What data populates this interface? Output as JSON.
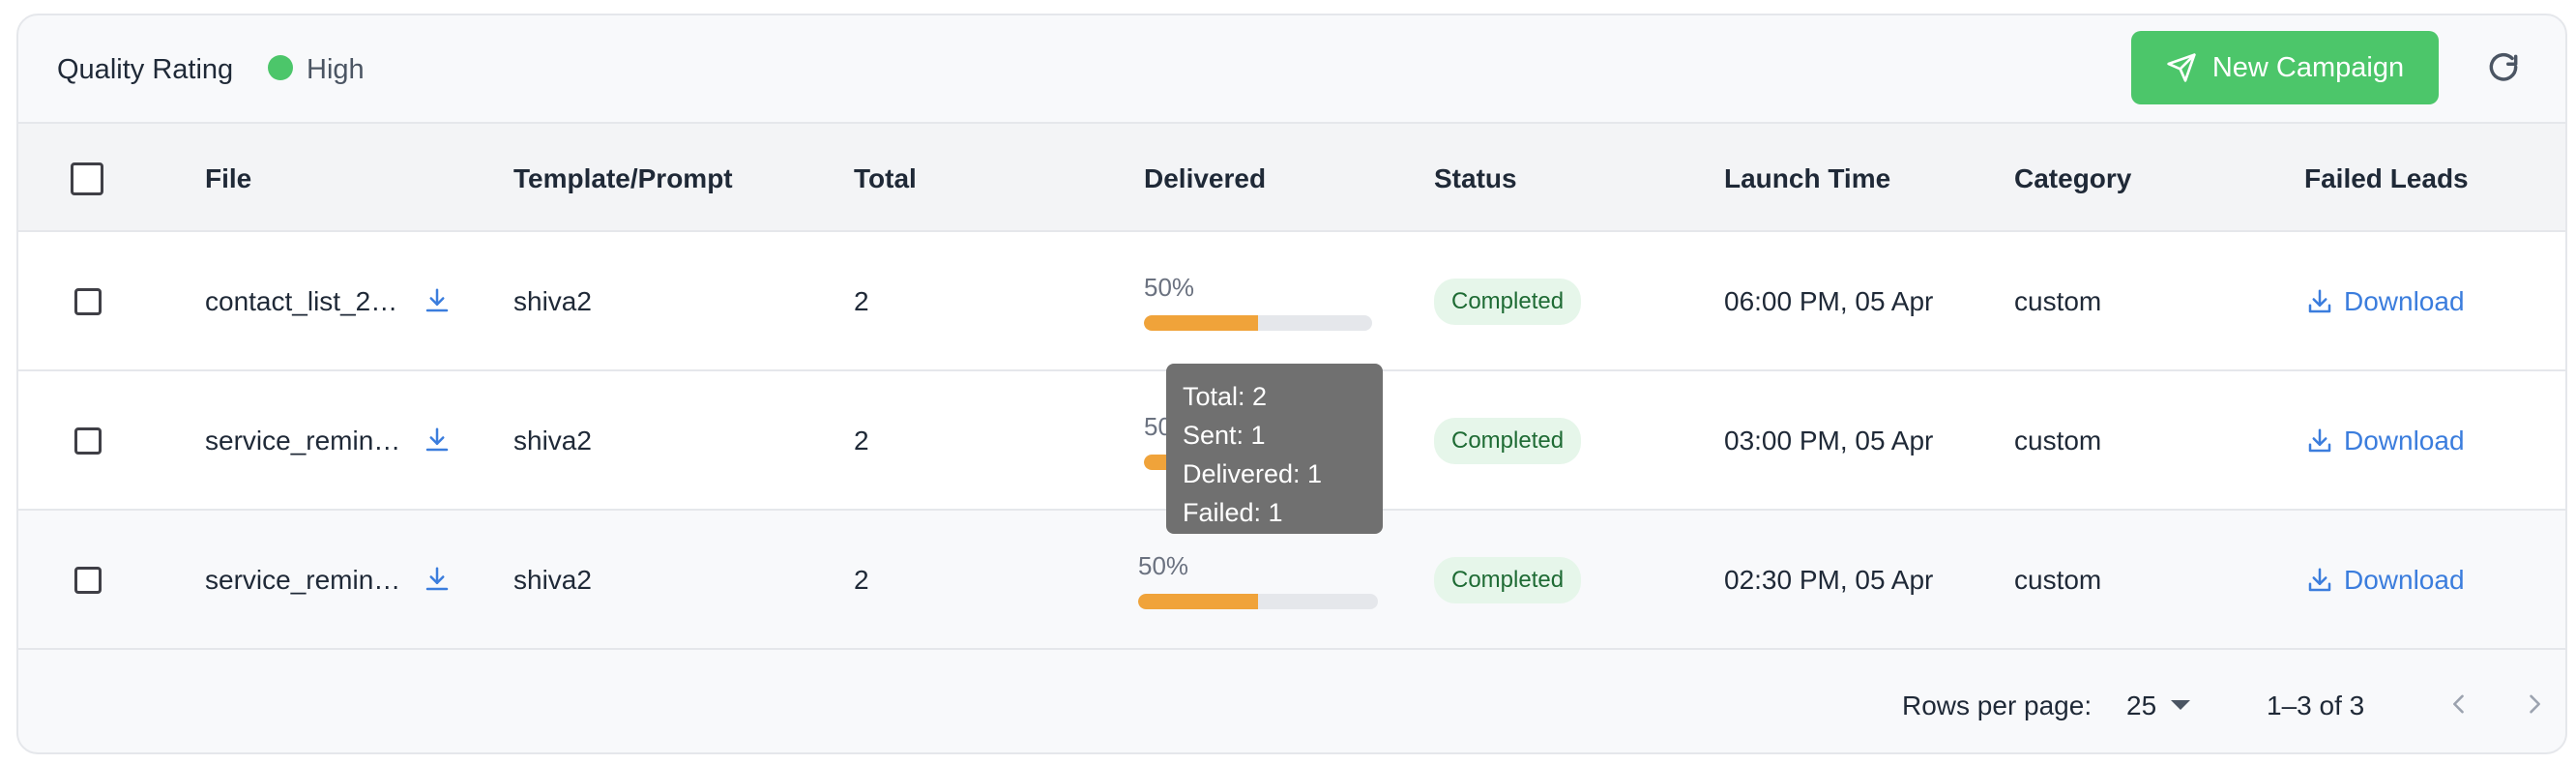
{
  "header": {
    "quality_label": "Quality Rating",
    "quality_value": "High",
    "quality_color": "#4cc66a",
    "new_campaign_label": "New Campaign",
    "refresh_icon": "refresh-icon"
  },
  "table": {
    "columns": [
      "File",
      "Template/Prompt",
      "Total",
      "Delivered",
      "Status",
      "Launch Time",
      "Category",
      "Failed Leads"
    ],
    "rows": [
      {
        "file": "contact_list_2…",
        "template": "shiva2",
        "total": "2",
        "delivered_label": "50%",
        "delivered_fraction": 0.5,
        "status": "Completed",
        "launch_time": "06:00 PM, 05 Apr",
        "category": "custom",
        "failed_leads": "Download"
      },
      {
        "file": "service_remin…",
        "template": "shiva2",
        "total": "2",
        "delivered_label": "50%",
        "delivered_fraction": 0.5,
        "status": "Completed",
        "launch_time": "03:00 PM, 05 Apr",
        "category": "custom",
        "failed_leads": "Download"
      },
      {
        "file": "service_remin…",
        "template": "shiva2",
        "total": "2",
        "delivered_label": "50%",
        "delivered_fraction": 0.5,
        "status": "Completed",
        "launch_time": "02:30 PM, 05 Apr",
        "category": "custom",
        "failed_leads": "Download"
      }
    ]
  },
  "tooltip": {
    "total": "Total: 2",
    "sent": "Sent: 1",
    "delivered": "Delivered: 1",
    "failed": "Failed: 1"
  },
  "footer": {
    "rows_per_page_label": "Rows per page:",
    "rows_per_page_value": "25",
    "range": "1–3 of 3"
  },
  "colors": {
    "accent_green": "#4cc66a",
    "progress": "#f0a33a",
    "link_blue": "#3b7ddd",
    "badge_bg": "#e6f6ea"
  }
}
